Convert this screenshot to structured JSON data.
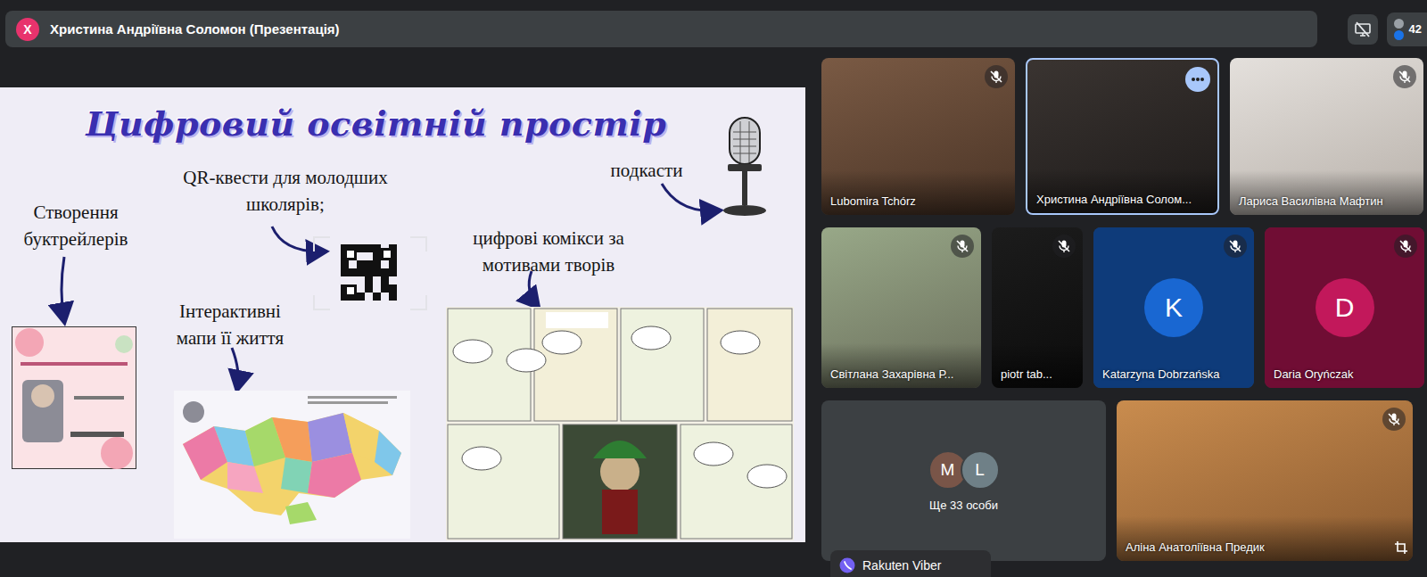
{
  "top_bar": {
    "avatar_initial": "Х",
    "title": "Христина Андріївна Соломон (Презентація)",
    "participant_count": "42"
  },
  "slide": {
    "title": "Цифровий освітній простір",
    "podcasts": "подкасти",
    "qr_quests": "QR-квести для молодших школярів;",
    "booktrailers": "Створення буктрейлерів",
    "maps": "Інтерактивні мапи її життя",
    "comics": "цифрові комікси за мотивами творів"
  },
  "tile_rows": [
    {
      "tiles": [
        {
          "kind": "video",
          "name": "Lubomira Tchórz",
          "muted": true,
          "speaking": false
        },
        {
          "kind": "video",
          "name": "Христина Андріївна Солом...",
          "muted": false,
          "speaking": true
        },
        {
          "kind": "video",
          "name": "Лариса Василівна Мафтин",
          "muted": true,
          "speaking": false
        }
      ]
    },
    {
      "tiles": [
        {
          "kind": "video",
          "name": "Світлана Захарівна Р...",
          "muted": true,
          "speaking": false
        },
        {
          "kind": "video",
          "name": "piotr tab...",
          "muted": true,
          "speaking": false
        },
        {
          "kind": "avatar",
          "name": "Katarzyna Dobrzańska",
          "initial": "K",
          "color": "#1967d2",
          "muted": true,
          "speaking": false
        },
        {
          "kind": "avatar",
          "name": "Daria Oryńczak",
          "initial": "D",
          "color": "#c2185b",
          "muted": true,
          "speaking": false
        }
      ]
    },
    {
      "tiles": [
        {
          "kind": "group",
          "label": "Ще 33 особи",
          "initials": [
            {
              "text": "M",
              "color": "#795548"
            },
            {
              "text": "L",
              "color": "#6f8087"
            }
          ]
        },
        {
          "kind": "video",
          "name": "Аліна Анатоліївна Предик",
          "muted": true,
          "speaking": false
        }
      ]
    }
  ],
  "notification": {
    "text": "Rakuten Viber"
  }
}
